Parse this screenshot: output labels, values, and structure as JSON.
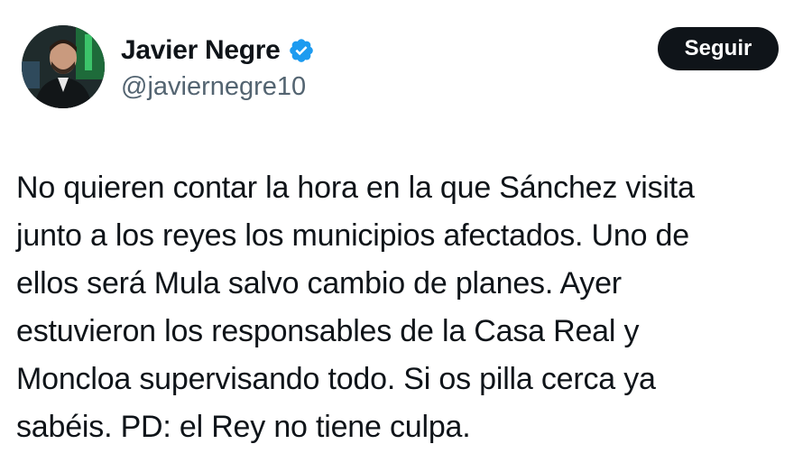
{
  "tweet": {
    "author": {
      "display_name": "Javier Negre",
      "handle": "@javiernegre10",
      "verified": true,
      "verified_icon": "verified-badge-icon",
      "verified_color": "#1d9bf0"
    },
    "follow_label": "Seguir",
    "text_lines": [
      "No quieren contar la hora en la que Sánchez visita",
      "junto a los reyes los municipios afectados. Uno de",
      "ellos será Mula salvo cambio de planes. Ayer",
      "estuvieron los responsables de la Casa Real y",
      "Moncloa supervisando todo. Si os pilla cerca ya",
      "sabéis. PD: el Rey no tiene culpa."
    ]
  }
}
